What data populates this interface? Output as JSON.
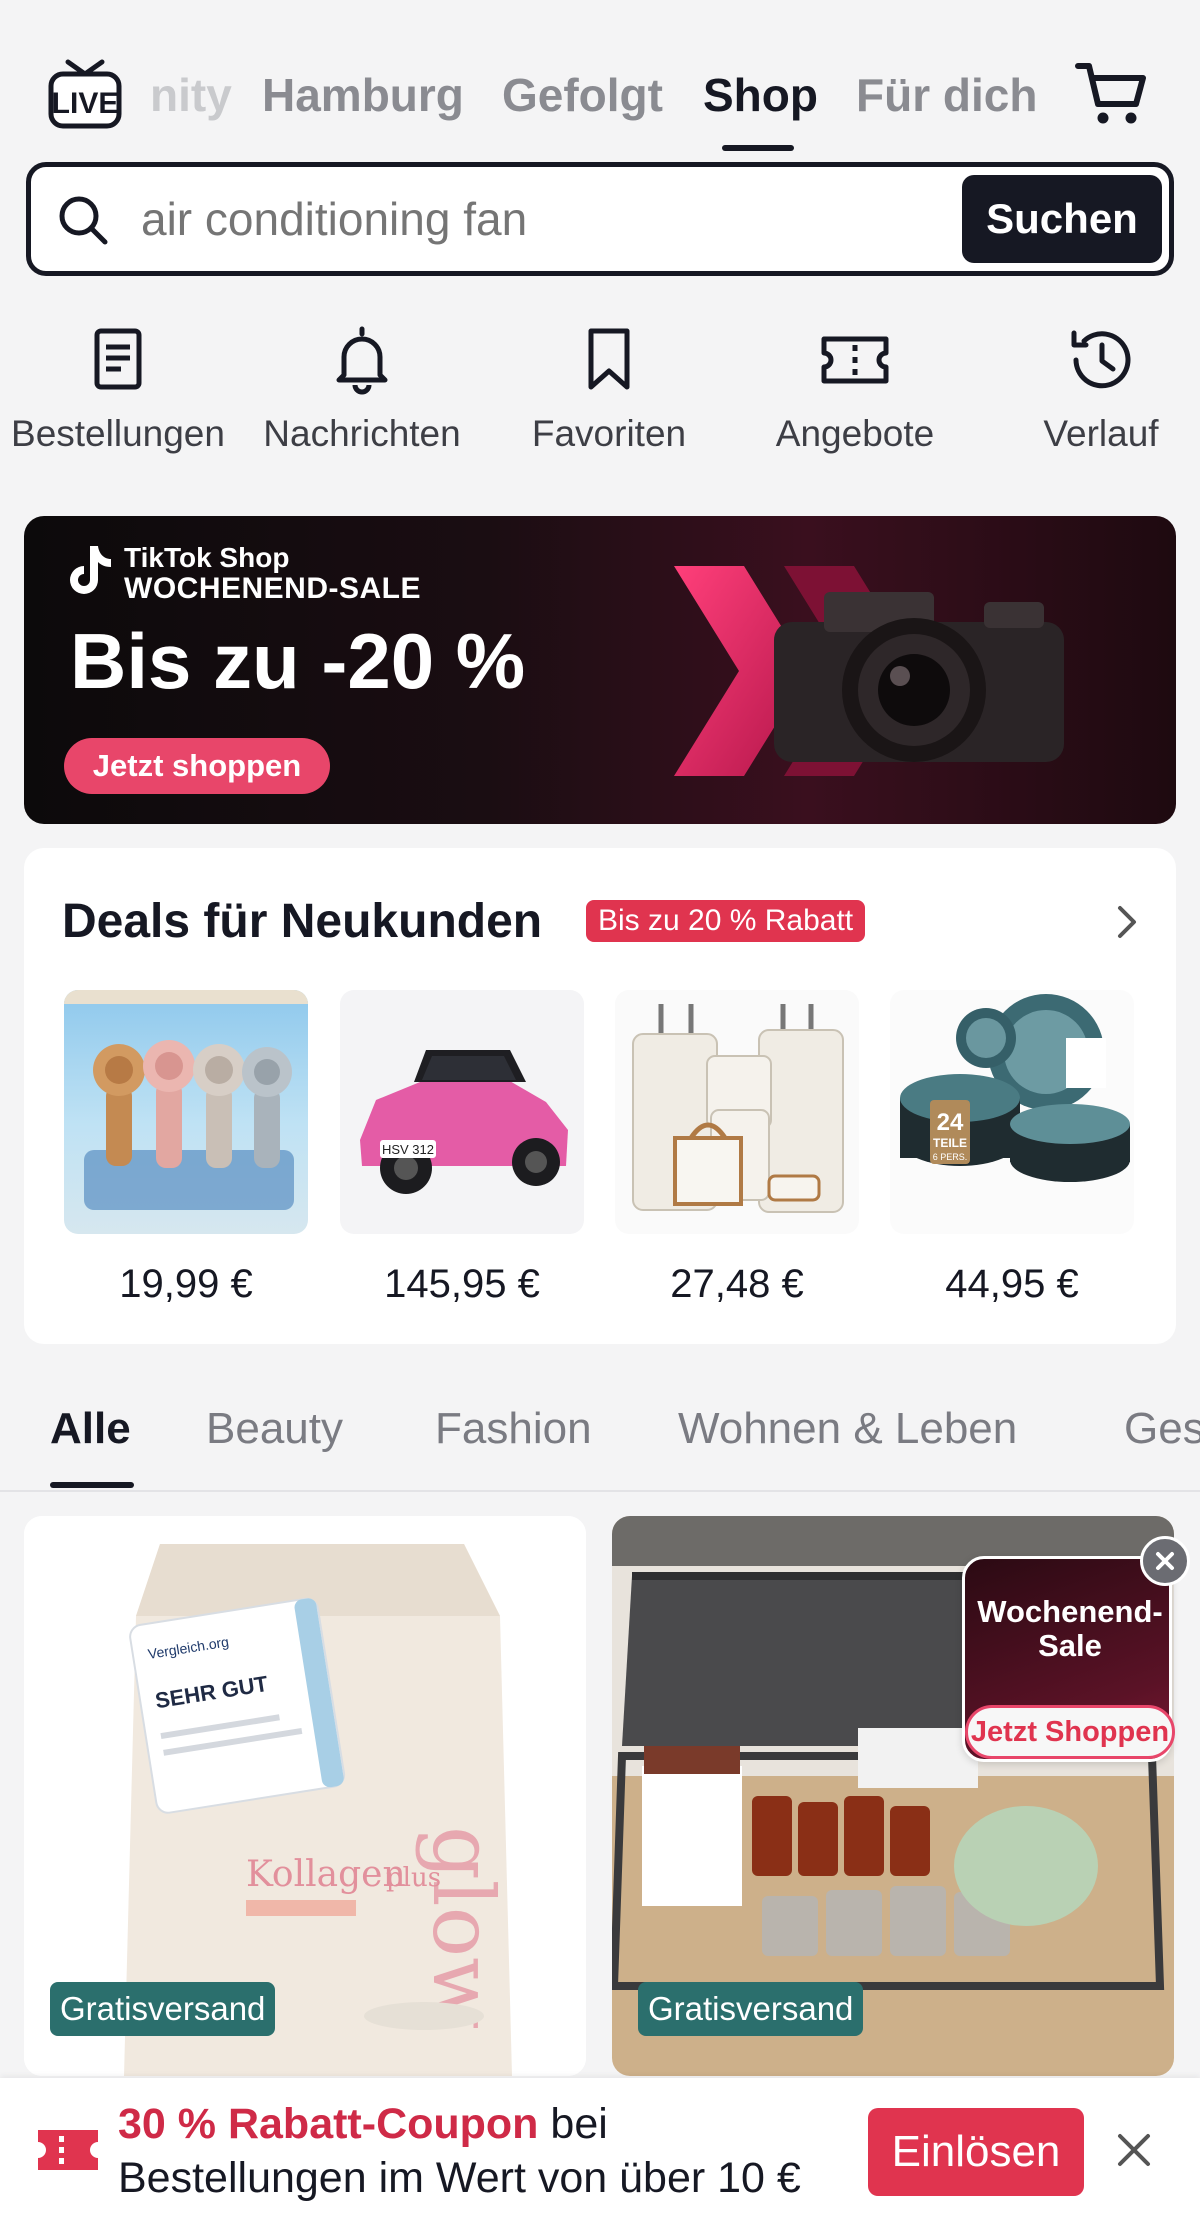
{
  "topnav": {
    "tabs": [
      {
        "label": "nity"
      },
      {
        "label": "Hamburg"
      },
      {
        "label": "Gefolgt"
      },
      {
        "label": "Shop"
      },
      {
        "label": "Für dich"
      }
    ],
    "live_icon": "live-tv-icon",
    "cart_icon": "shopping-cart-icon"
  },
  "search": {
    "placeholder": "air conditioning fan",
    "button_label": "Suchen"
  },
  "quick_actions": [
    {
      "label": "Bestellungen",
      "icon": "orders-icon"
    },
    {
      "label": "Nachrichten",
      "icon": "bell-icon"
    },
    {
      "label": "Favoriten",
      "icon": "bookmark-icon"
    },
    {
      "label": "Angebote",
      "icon": "ticket-icon"
    },
    {
      "label": "Verlauf",
      "icon": "history-icon"
    }
  ],
  "banner": {
    "brand": "TikTok Shop",
    "subtitle": "WOCHENEND-SALE",
    "headline": "Bis zu -20 %",
    "cta": "Jetzt shoppen"
  },
  "deals": {
    "title": "Deals für Neukunden",
    "badge": "Bis zu 20 % Rabatt",
    "items": [
      {
        "price": "19,99 €",
        "product": "handheld fans"
      },
      {
        "price": "145,95 €",
        "product": "pink ride-on car"
      },
      {
        "price": "27,48 €",
        "product": "luggage set"
      },
      {
        "price": "44,95 €",
        "product": "dinnerware set"
      }
    ],
    "dinnerware_tag": {
      "number": "24",
      "word": "TEILE",
      "sub": "6 PERS."
    },
    "car_plate": "HSV 312"
  },
  "categories": [
    "Alle",
    "Beauty",
    "Fashion",
    "Wohnen & Leben",
    "Ges"
  ],
  "products": [
    {
      "badge": "Gratisversand",
      "pack_brand": "glow",
      "pack_name": "Kollagen",
      "pack_name_suffix": "plus",
      "seal_title": "SEHR GUT",
      "seal_brand": "Vergleich.org"
    },
    {
      "badge": "Gratisversand"
    }
  ],
  "promo": {
    "title_line1": "Wochenend-",
    "title_line2": "Sale",
    "cta": "Jetzt Shoppen"
  },
  "coupon": {
    "highlight": "30 % Rabatt-Coupon",
    "line1_rest": " bei",
    "line2": "Bestellungen im Wert von über 10 €",
    "button": "Einlösen"
  },
  "colors": {
    "accent": "#e0344f",
    "free_shipping": "#2b6f6d",
    "text_primary": "#161823"
  }
}
